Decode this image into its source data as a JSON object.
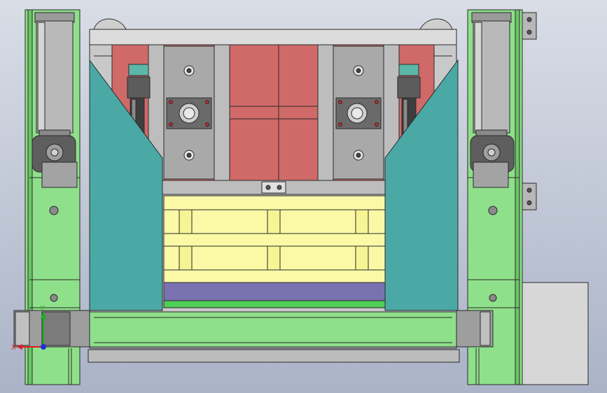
{
  "viewport": {
    "background_top": "#d9dde6",
    "background_bottom": "#aab3c7"
  },
  "colors": {
    "frame_green": "#8fe08a",
    "frame_green_dark": "#6cc566",
    "teal_guard": "#4aa9a5",
    "red_panel": "#d06a69",
    "yellow_slats": "#fbf9a6",
    "purple_belt": "#7a72b0",
    "gray_steel": "#b8b8b8",
    "dark_steel": "#6b6b6b",
    "outline": "#2a2a2a"
  },
  "triad": {
    "x_label": "X",
    "y_label": "Y",
    "x_color": "#e11b1b",
    "y_color": "#17b51a",
    "z_color": "#1d2fd6"
  }
}
